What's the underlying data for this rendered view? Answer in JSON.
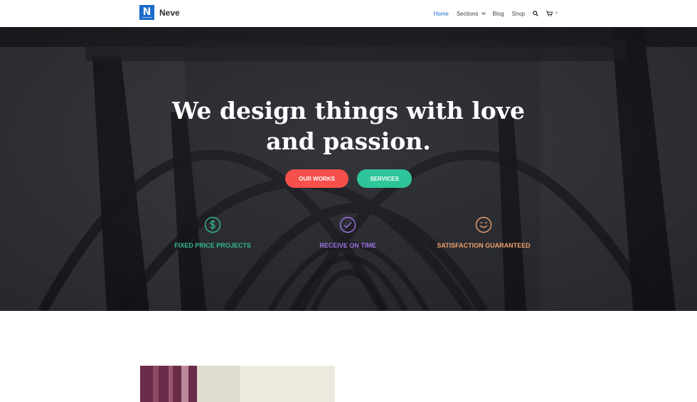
{
  "header": {
    "logo_letter": "N",
    "site_name": "Neve",
    "nav": [
      {
        "label": "Home",
        "active": true
      },
      {
        "label": "Sections",
        "has_dropdown": true
      },
      {
        "label": "Blog"
      },
      {
        "label": "Shop"
      }
    ],
    "search_icon": "search-icon",
    "cart_icon": "cart-icon",
    "cart_count": "0"
  },
  "hero": {
    "title_line1": "We design things with love",
    "title_line2": "and passion.",
    "buttons": [
      {
        "label": "OUR WORKS",
        "color": "#f5504b"
      },
      {
        "label": "SERVICES",
        "color": "#2fc59b"
      }
    ],
    "features": [
      {
        "label": "FIXED PRICE PROJECTS",
        "icon": "dollar-icon",
        "color": "#35b991"
      },
      {
        "label": "RECEIVE ON TIME",
        "icon": "clock-icon",
        "color": "#a173e5"
      },
      {
        "label": "SATISFACTION GUARANTEED",
        "icon": "smile-icon",
        "color": "#f1a06a"
      }
    ]
  },
  "colors": {
    "accent": "#1b6ac9"
  }
}
